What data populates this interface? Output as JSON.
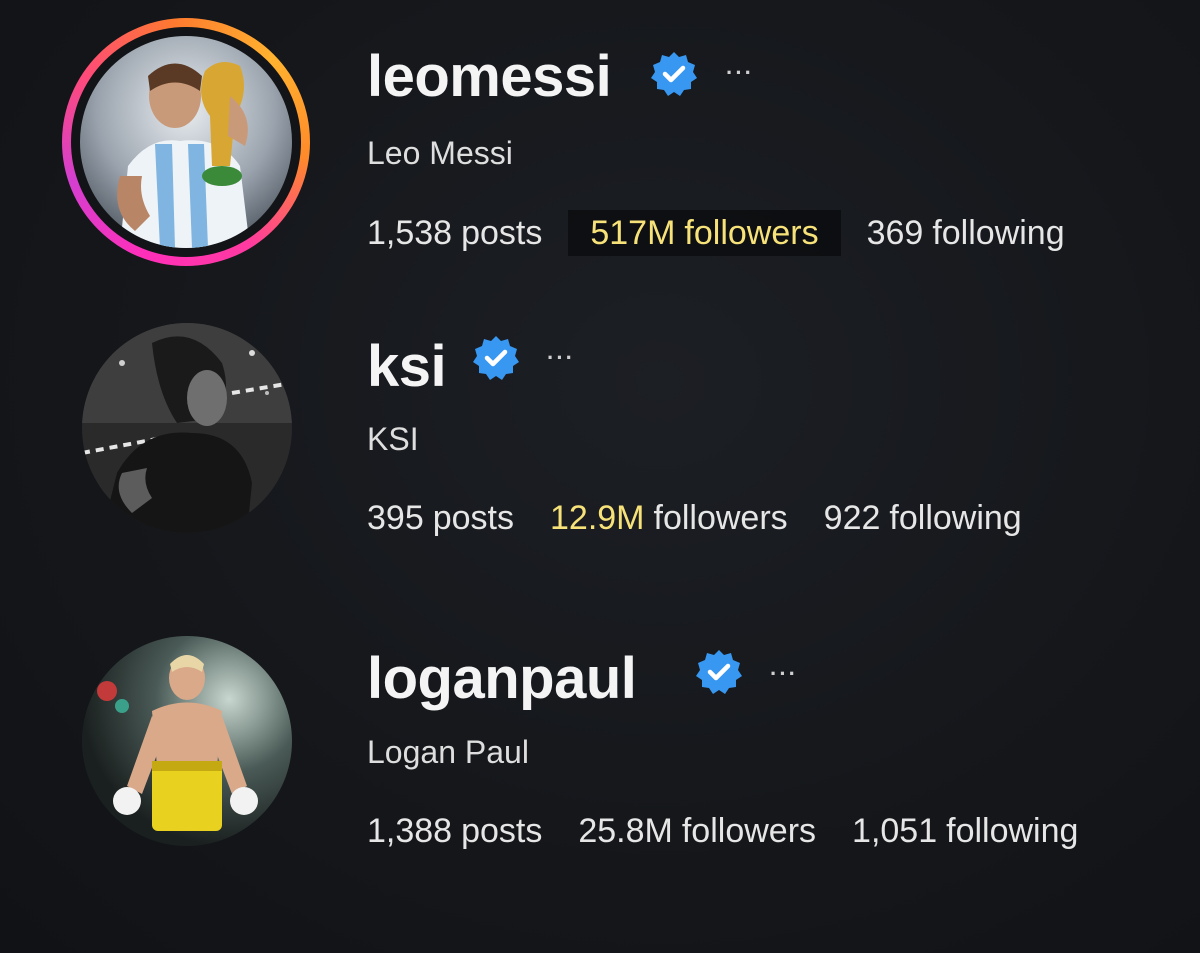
{
  "profiles": [
    {
      "username": "leomessi",
      "full_name": "Leo Messi",
      "verified": true,
      "more_label": "···",
      "stats": {
        "posts_num": "1,538",
        "posts_label": "posts",
        "followers_num": "517M",
        "followers_label": "followers",
        "following_num": "369",
        "following_label": "following"
      },
      "has_story_ring": true
    },
    {
      "username": "ksi",
      "full_name": "KSI",
      "verified": true,
      "more_label": "···",
      "stats": {
        "posts_num": "395",
        "posts_label": "posts",
        "followers_num": "12.9M",
        "followers_label": "followers",
        "following_num": "922",
        "following_label": "following"
      },
      "has_story_ring": false
    },
    {
      "username": "loganpaul",
      "full_name": "Logan Paul",
      "verified": true,
      "more_label": "···",
      "stats": {
        "posts_num": "1,388",
        "posts_label": "posts",
        "followers_num": "25.8M",
        "followers_label": "followers",
        "following_num": "1,051",
        "following_label": "following"
      },
      "has_story_ring": false
    }
  ],
  "colors": {
    "background": "#15171b",
    "verified_badge": "#3897f0",
    "highlight_text": "#f7e27a",
    "story_ring_start": "#ff2fb9",
    "story_ring_end": "#ffb32f"
  }
}
